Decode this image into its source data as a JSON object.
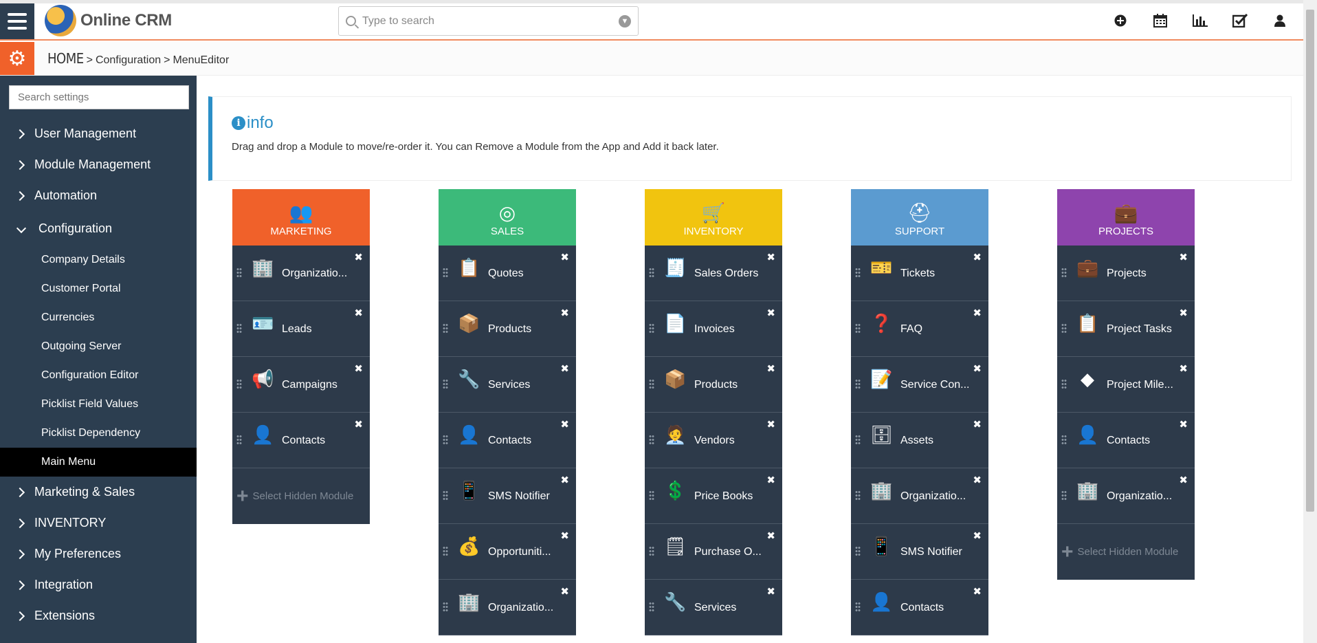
{
  "header": {
    "app_name": "Online CRM",
    "search_placeholder": "Type to search",
    "icons": [
      "add-icon",
      "calendar-icon",
      "reports-icon",
      "tasks-icon",
      "user-icon"
    ]
  },
  "breadcrumb": {
    "home": "HOME",
    "items": [
      "Configuration",
      "MenuEditor"
    ]
  },
  "sidebar": {
    "search_placeholder": "Search settings",
    "items": [
      {
        "label": "User Management"
      },
      {
        "label": "Module Management"
      },
      {
        "label": "Automation"
      },
      {
        "label": "Configuration",
        "open": true
      }
    ],
    "sub_items": [
      {
        "label": "Company Details"
      },
      {
        "label": "Customer Portal"
      },
      {
        "label": "Currencies"
      },
      {
        "label": "Outgoing Server"
      },
      {
        "label": "Configuration Editor"
      },
      {
        "label": "Picklist Field Values"
      },
      {
        "label": "Picklist Dependency"
      },
      {
        "label": "Main Menu",
        "active": true
      }
    ],
    "items_after": [
      {
        "label": "Marketing & Sales"
      },
      {
        "label": "INVENTORY"
      },
      {
        "label": "My Preferences"
      },
      {
        "label": "Integration"
      },
      {
        "label": "Extensions"
      }
    ]
  },
  "info": {
    "title": "info",
    "text": "Drag and drop a Module to move/re-order it. You can Remove a Module from the App and Add it back later."
  },
  "add_hidden_label": "Select Hidden Module",
  "columns": [
    {
      "name": "MARKETING",
      "color": "#f0612a",
      "icon": "group-icon",
      "modules": [
        "Organizatio...",
        "Leads",
        "Campaigns",
        "Contacts"
      ],
      "add_hidden": true
    },
    {
      "name": "SALES",
      "color": "#3cba7a",
      "icon": "target-icon",
      "modules": [
        "Quotes",
        "Products",
        "Services",
        "Contacts",
        "SMS Notifier",
        "Opportuniti...",
        "Organizatio..."
      ],
      "add_hidden": false
    },
    {
      "name": "INVENTORY",
      "color": "#f1c40f",
      "icon": "cart-icon",
      "modules": [
        "Sales Orders",
        "Invoices",
        "Products",
        "Vendors",
        "Price Books",
        "Purchase O...",
        "Services"
      ],
      "add_hidden": false
    },
    {
      "name": "SUPPORT",
      "color": "#5b9bd0",
      "icon": "lifebuoy-icon",
      "modules": [
        "Tickets",
        "FAQ",
        "Service Con...",
        "Assets",
        "Organizatio...",
        "SMS Notifier",
        "Contacts"
      ],
      "add_hidden": false
    },
    {
      "name": "PROJECTS",
      "color": "#8e44ad",
      "icon": "briefcase-icon",
      "modules": [
        "Projects",
        "Project Tasks",
        "Project Mile...",
        "Contacts",
        "Organizatio..."
      ],
      "add_hidden": true
    }
  ]
}
